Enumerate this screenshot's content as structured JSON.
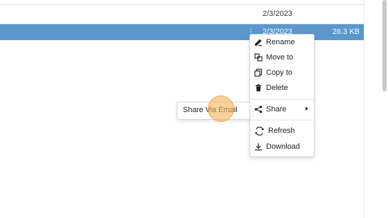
{
  "file_list": {
    "rows": [
      {
        "date": "2/3/2023",
        "size": ""
      },
      {
        "date": "2/3/2023",
        "size": "26.3 KB",
        "row_menu_icon": "vertical-ellipsis-icon"
      }
    ]
  },
  "context_menu": {
    "items": [
      {
        "label": "Rename",
        "icon": "pencil-icon"
      },
      {
        "label": "Move to",
        "icon": "move-icon"
      },
      {
        "label": "Copy to",
        "icon": "copy-icon"
      },
      {
        "label": "Delete",
        "icon": "trash-icon"
      },
      {
        "label": "Share",
        "icon": "share-icon"
      },
      {
        "label": "Refresh",
        "icon": "refresh-icon"
      },
      {
        "label": "Download",
        "icon": "download-icon"
      }
    ]
  },
  "share_submenu": {
    "items": [
      {
        "label": "Share Via Email"
      }
    ]
  },
  "colors": {
    "selected_row": "#5b97cd",
    "cursor_highlight": "#f7b05c"
  }
}
